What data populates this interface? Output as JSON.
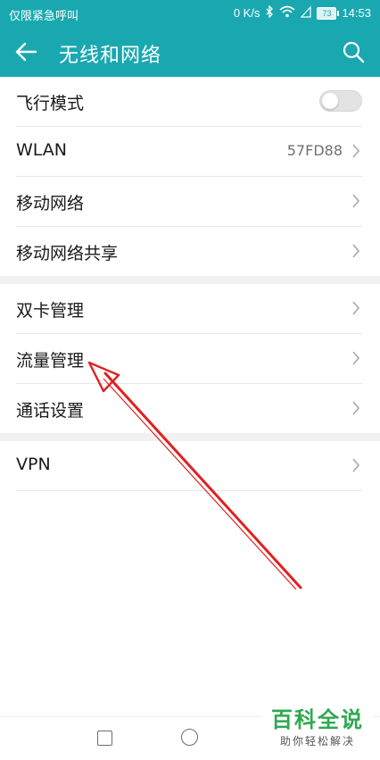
{
  "status_bar": {
    "carrier_text": "仅限紧急呼叫",
    "network_speed": "0 K/s",
    "battery_level": "73",
    "time": "14:53"
  },
  "app_bar": {
    "title": "无线和网络",
    "back_icon": "arrow-left-icon",
    "search_icon": "search-icon"
  },
  "sections": [
    {
      "items": [
        {
          "label": "飞行模式",
          "control": "toggle",
          "toggle_on": false
        },
        {
          "label": "WLAN",
          "value": "57FD88",
          "control": "chevron"
        },
        {
          "label": "移动网络",
          "control": "chevron"
        },
        {
          "label": "移动网络共享",
          "control": "chevron"
        }
      ]
    },
    {
      "items": [
        {
          "label": "双卡管理",
          "control": "chevron"
        },
        {
          "label": "流量管理",
          "control": "chevron"
        },
        {
          "label": "通话设置",
          "control": "chevron"
        }
      ]
    },
    {
      "items": [
        {
          "label": "VPN",
          "control": "chevron"
        }
      ]
    }
  ],
  "annotation": {
    "type": "red-arrow",
    "points_to": "流量管理",
    "color": "#e02020"
  },
  "watermark": {
    "main": "百科全说",
    "sub": "助你轻松解决"
  },
  "colors": {
    "accent": "#1aa8b0",
    "watermark": "#2fa84f"
  }
}
